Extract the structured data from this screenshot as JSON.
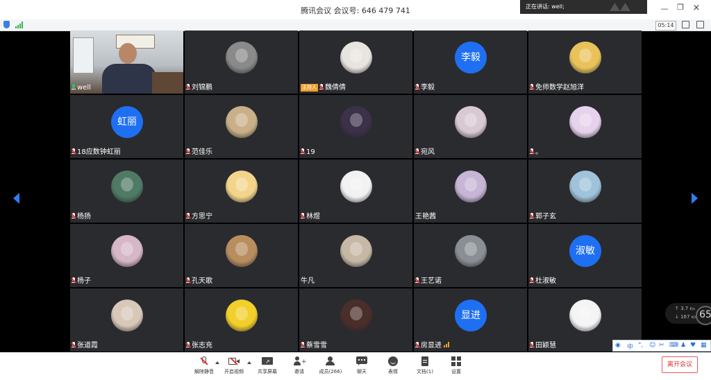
{
  "window": {
    "title": "腾讯会议 会议号: 646 479 741",
    "speaking": "正在讲话: well;"
  },
  "toolbar": {
    "timer": "05:14"
  },
  "participants": [
    {
      "name": "well",
      "mic": "on",
      "avatar": "video"
    },
    {
      "name": "刘锦鹏",
      "mic": "muted",
      "avatar": "image",
      "color": "#8a8a8a"
    },
    {
      "name": "魏倩倩",
      "mic": "muted",
      "avatar": "image",
      "color": "#e8e4e0",
      "host": "主持人"
    },
    {
      "name": "李毅",
      "mic": "muted",
      "avatar": "text",
      "avatar_text": "李毅"
    },
    {
      "name": "免师数学赵旭洋",
      "mic": "muted",
      "avatar": "image",
      "color": "#e9c35a"
    },
    {
      "name": "18应数钟虹丽",
      "mic": "muted",
      "avatar": "text",
      "avatar_text": "虹丽"
    },
    {
      "name": "范佳乐",
      "mic": "muted",
      "avatar": "image",
      "color": "#c9b088"
    },
    {
      "name": "19",
      "mic": "muted",
      "avatar": "image",
      "color": "#3b3148"
    },
    {
      "name": "宛风",
      "mic": "muted",
      "avatar": "image",
      "color": "#d8c9d4"
    },
    {
      "name": "。",
      "mic": "muted",
      "avatar": "image",
      "color": "#e6d2ec"
    },
    {
      "name": "杨扬",
      "mic": "muted",
      "avatar": "image",
      "color": "#4f7a66"
    },
    {
      "name": "方思宁",
      "mic": "muted",
      "avatar": "image",
      "color": "#f3d48b"
    },
    {
      "name": "林煜",
      "mic": "muted",
      "avatar": "image",
      "color": "#f2f2f2"
    },
    {
      "name": "王艳茜",
      "mic": "none",
      "avatar": "image",
      "color": "#c7b5d6"
    },
    {
      "name": "郭子玄",
      "mic": "muted",
      "avatar": "image",
      "color": "#9fc3db"
    },
    {
      "name": "杨子",
      "mic": "muted",
      "avatar": "image",
      "color": "#d6b7c7"
    },
    {
      "name": "孔天歌",
      "mic": "muted",
      "avatar": "image",
      "color": "#b98e5f"
    },
    {
      "name": "牛凡",
      "mic": "none",
      "avatar": "image",
      "color": "#c7b8a5"
    },
    {
      "name": "王艺诺",
      "mic": "muted",
      "avatar": "image",
      "color": "#8a8f95"
    },
    {
      "name": "杜淑敏",
      "mic": "muted",
      "avatar": "text",
      "avatar_text": "淑敏"
    },
    {
      "name": "张道霞",
      "mic": "muted",
      "avatar": "image",
      "color": "#d8c8b8"
    },
    {
      "name": "张志充",
      "mic": "muted",
      "avatar": "image",
      "color": "#f2cf2a"
    },
    {
      "name": "蔡雪雪",
      "mic": "muted",
      "avatar": "image",
      "color": "#4a2e2a"
    },
    {
      "name": "房显进",
      "mic": "muted",
      "avatar": "text",
      "avatar_text": "显进",
      "signal": true
    },
    {
      "name": "田颖慧",
      "mic": "muted",
      "avatar": "image",
      "color": "#f4f4f4"
    }
  ],
  "net": {
    "up": "3.7",
    "down": "167",
    "unit": "K/s",
    "value": "65"
  },
  "ime": {
    "lang": "中"
  },
  "bottom": {
    "unmute": "解除静音",
    "video": "开启视频",
    "share": "共享屏幕",
    "invite": "邀请",
    "members": "成员(266)",
    "chat": "聊天",
    "emoji": "表情",
    "docs": "文档(1)",
    "settings": "设置",
    "leave": "离开会议"
  },
  "colors": {
    "accent": "#1e6ff2",
    "tile": "#2a2b2e",
    "leave": "#e03030"
  }
}
